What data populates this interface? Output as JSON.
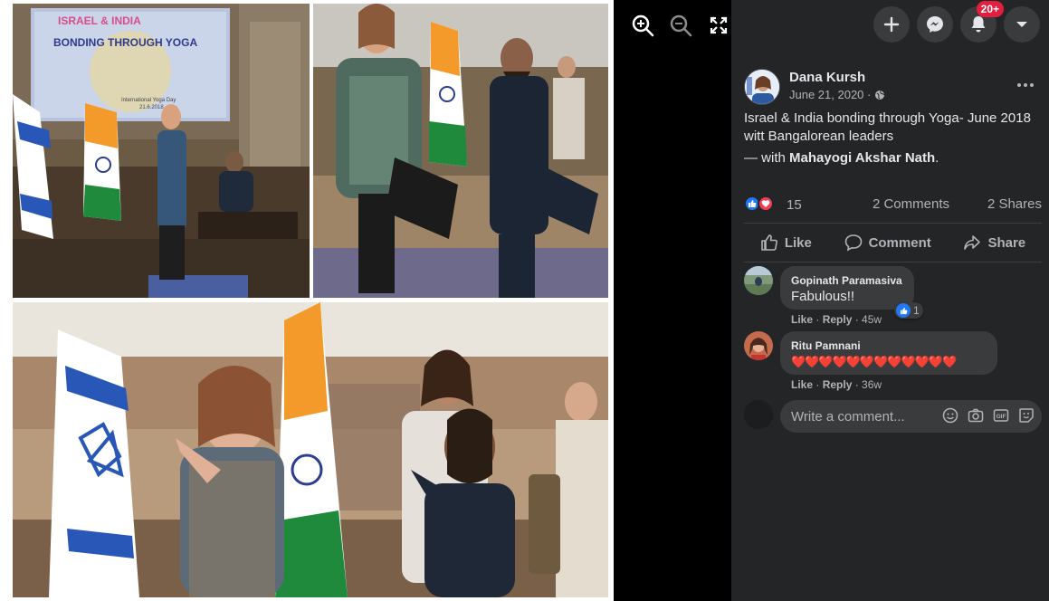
{
  "viewer": {
    "tools": [
      {
        "icon": "zoom-in-icon"
      },
      {
        "icon": "zoom-out-icon"
      },
      {
        "icon": "fullscreen-icon"
      }
    ],
    "photo_panels": [
      {
        "name": "conference-slide",
        "slide_title": "ISRAEL & INDIA",
        "slide_subtitle": "BONDING THROUGH YOGA",
        "slide_footer": "International Yoga Day",
        "slide_date": "21.6.2018"
      },
      {
        "name": "namaste-pose"
      },
      {
        "name": "arms-extended-pose"
      }
    ]
  },
  "topbar": {
    "buttons": [
      {
        "icon": "plus-icon"
      },
      {
        "icon": "messenger-icon"
      },
      {
        "icon": "notifications-icon",
        "badge": "20+"
      },
      {
        "icon": "account-menu-icon"
      }
    ]
  },
  "post": {
    "author": "Dana Kursh",
    "date": "June 21, 2020 ·",
    "privacy_icon": "globe-icon",
    "text_line1": "Israel & India bonding through Yoga- June 2018",
    "text_line2": "witt Bangalorean leaders",
    "with_prefix": "— with ",
    "with_name": "Mahayogi Akshar Nath",
    "with_suffix": ".",
    "reaction_count": "15",
    "comments_label": "2 Comments",
    "shares_label": "2 Shares",
    "actions": [
      {
        "label": "Like",
        "icon": "like-icon"
      },
      {
        "label": "Comment",
        "icon": "comment-icon"
      },
      {
        "label": "Share",
        "icon": "share-icon"
      }
    ]
  },
  "comments": [
    {
      "name": "Gopinath Paramasiva",
      "text": "Fabulous!!",
      "like": "Like",
      "reply": "Reply",
      "time": "45w",
      "reaction_count": "1"
    },
    {
      "name": "Ritu Pamnani",
      "text": "❤️❤️❤️❤️❤️❤️❤️❤️❤️❤️❤️❤️",
      "like": "Like",
      "reply": "Reply",
      "time": "36w"
    }
  ],
  "composer": {
    "placeholder": "Write a comment...",
    "tools": [
      "emoji-icon",
      "camera-icon",
      "gif-icon",
      "sticker-icon"
    ]
  },
  "colors": {
    "panel_bg": "#242526",
    "bubble_bg": "#3a3b3c",
    "like_blue": "#2078f4",
    "love_red": "#f33e58",
    "badge_red": "#e41e3f"
  }
}
